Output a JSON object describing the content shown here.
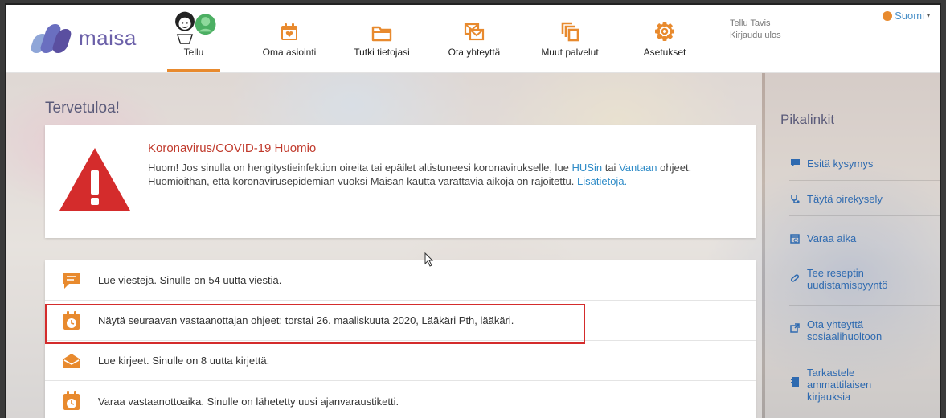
{
  "header": {
    "logo_text": "maisa",
    "nav": [
      {
        "label": "Tellu",
        "icon": "child-avatar-icon"
      },
      {
        "label": "Oma asiointi",
        "icon": "calendar-heart-icon"
      },
      {
        "label": "Tutki tietojasi",
        "icon": "folder-icon"
      },
      {
        "label": "Ota yhteyttä",
        "icon": "envelope-icon"
      },
      {
        "label": "Muut palvelut",
        "icon": "copy-icon"
      },
      {
        "label": "Asetukset",
        "icon": "gear-icon"
      }
    ],
    "user_name": "Tellu Tavis",
    "logout": "Kirjaudu ulos",
    "language": "Suomi"
  },
  "main": {
    "welcome": "Tervetuloa!",
    "covid": {
      "title": "Koronavirus/COVID-19 Huomio",
      "text_1": "Huom! Jos sinulla on hengitystieinfektion oireita tai epäilet altistuneesi koronavirukselle, lue ",
      "link_hus": "HUSin",
      "text_2": " tai ",
      "link_vantaa": "Vantaan",
      "text_3": " ohjeet. Huomioithan, että koronavirusepidemian vuoksi Maisan kautta varattavia aikoja on rajoitettu. ",
      "link_more": "Lisätietoja."
    },
    "messages": [
      {
        "icon": "chat-icon",
        "text": "Lue viestejä. Sinulle on 54 uutta viestiä."
      },
      {
        "icon": "calendar-clock-icon",
        "text": "Näytä seuraavan vastaanottajan ohjeet: torstai 26. maaliskuuta 2020, Lääkäri Pth, lääkäri."
      },
      {
        "icon": "mail-icon",
        "text": "Lue kirjeet. Sinulle on 8 uutta kirjettä."
      },
      {
        "icon": "calendar-clock-icon",
        "text": "Varaa vastaanottoaika. Sinulle on lähetetty uusi ajanvaraustiketti."
      }
    ]
  },
  "sidebar": {
    "title": "Pikalinkit",
    "links": [
      {
        "label": "Esitä kysymys",
        "icon": "chat-icon"
      },
      {
        "label": "Täytä oirekysely",
        "icon": "stethoscope-icon"
      },
      {
        "label": "Varaa aika",
        "icon": "calendar-icon"
      },
      {
        "label": "Tee reseptin uudistamispyyntö",
        "icon": "pill-icon"
      },
      {
        "label": "Ota yhteyttä sosiaalihuoltoon",
        "icon": "external-link-icon"
      },
      {
        "label": "Tarkastele ammattilaisen kirjauksia",
        "icon": "journal-icon"
      }
    ]
  },
  "colors": {
    "accent": "#e88a2e",
    "logo": "#6a5fa8",
    "alert": "#c0392b",
    "link": "#2e8bc7",
    "highlight": "#d42c2c"
  }
}
